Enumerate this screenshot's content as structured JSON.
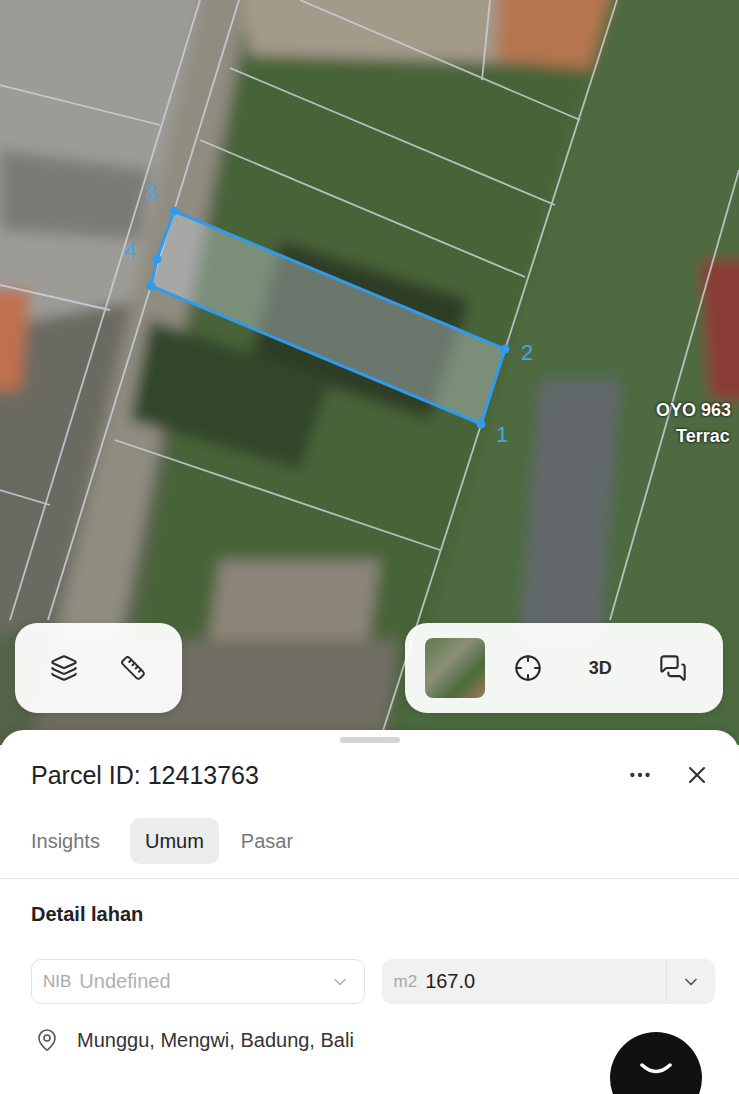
{
  "map": {
    "parcel": {
      "highlighted": true,
      "vertices": [
        {
          "label": "1"
        },
        {
          "label": "2"
        },
        {
          "label": "3"
        },
        {
          "label": "4"
        }
      ]
    },
    "place_label": [
      "OYO 963",
      "Terrac"
    ]
  },
  "map_tools": {
    "view_3d": "3D"
  },
  "sheet": {
    "title": "Parcel ID: 12413763",
    "tabs": [
      {
        "label": "Insights",
        "selected": false
      },
      {
        "label": "Umum",
        "selected": true
      },
      {
        "label": "Pasar",
        "selected": false
      }
    ],
    "section": "Detail lahan",
    "nib": {
      "prefix": "NIB",
      "value": "Undefined",
      "disabled": true
    },
    "area": {
      "unit": "m2",
      "value": "167.0"
    },
    "location": "Munggu, Mengwi, Badung, Bali"
  }
}
